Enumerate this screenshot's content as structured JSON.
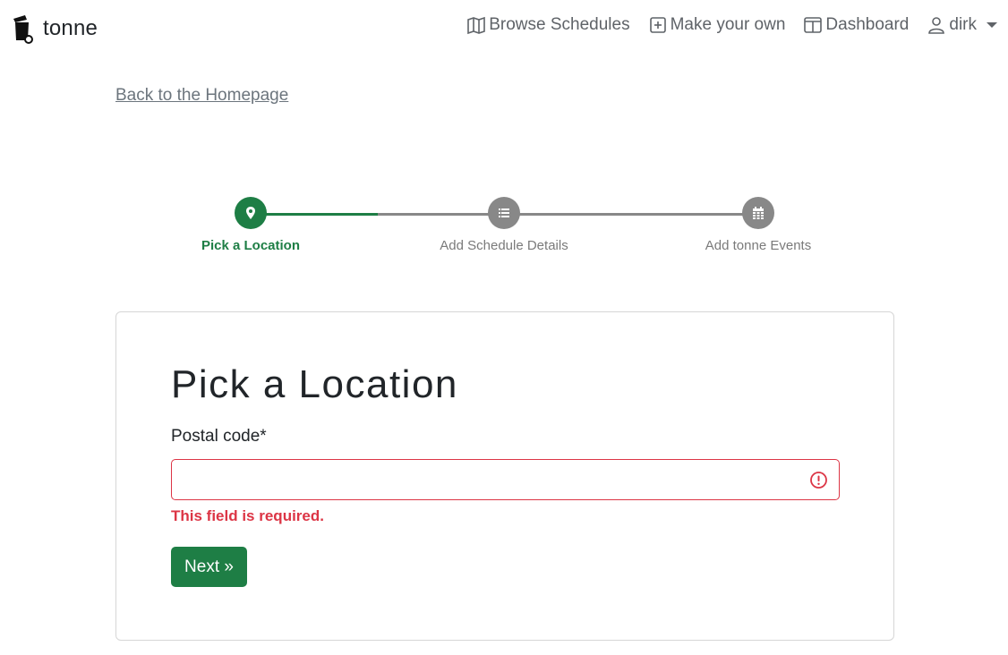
{
  "brand": {
    "name": "tonne",
    "icon": "trash-bin-icon"
  },
  "nav": {
    "items": [
      {
        "label": "Browse Schedules",
        "icon": "map-icon"
      },
      {
        "label": "Make your own",
        "icon": "plus-square-icon"
      },
      {
        "label": "Dashboard",
        "icon": "layout-icon"
      },
      {
        "label": "dirk",
        "icon": "person-icon"
      }
    ]
  },
  "back_link": "Back to the Homepage",
  "stepper": {
    "steps": [
      {
        "label": "Pick a Location",
        "icon": "location-pin-icon",
        "state": "active"
      },
      {
        "label": "Add Schedule Details",
        "icon": "list-icon",
        "state": "inactive"
      },
      {
        "label": "Add tonne Events",
        "icon": "calendar-icon",
        "state": "inactive"
      }
    ],
    "progress": 0.25
  },
  "form": {
    "title": "Pick a Location",
    "postal_label": "Postal code*",
    "postal_value": "",
    "error": "This field is required.",
    "next_label": "Next »"
  },
  "colors": {
    "accent": "#1e7e45",
    "error": "#dc3545",
    "muted": "#888888",
    "nav_text": "#5f6368"
  }
}
